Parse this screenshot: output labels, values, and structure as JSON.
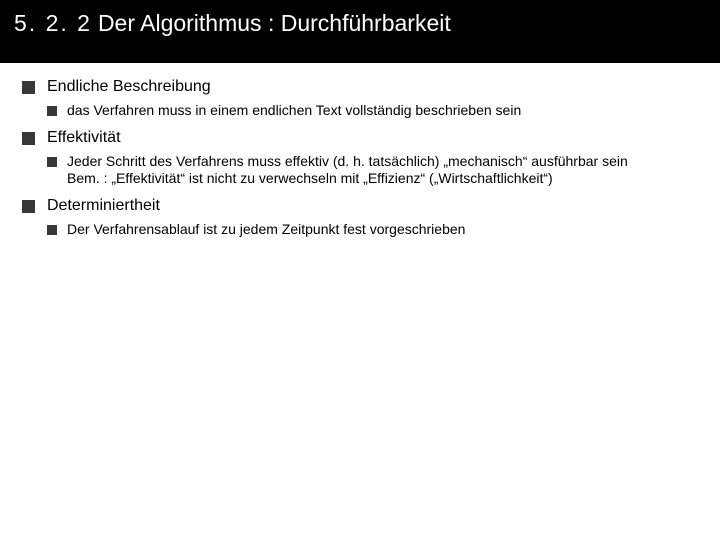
{
  "header": {
    "section_number": "5. 2. 2",
    "title": "Der Algorithmus : Durchführbarkeit"
  },
  "bullets": [
    {
      "label": "Endliche Beschreibung",
      "sub": [
        "das Verfahren muss in einem endlichen Text vollständig beschrieben sein"
      ]
    },
    {
      "label": "Effektivität",
      "sub": [
        "Jeder Schritt des Verfahrens muss effektiv (d. h. tatsächlich) „mechanisch“ ausführbar sein\nBem. : „Effektivität“ ist nicht zu verwechseln mit „Effizienz“ („Wirtschaftlichkeit“)"
      ]
    },
    {
      "label": "Determiniertheit",
      "sub": [
        "Der Verfahrensablauf ist zu jedem Zeitpunkt fest vorgeschrieben"
      ]
    }
  ]
}
